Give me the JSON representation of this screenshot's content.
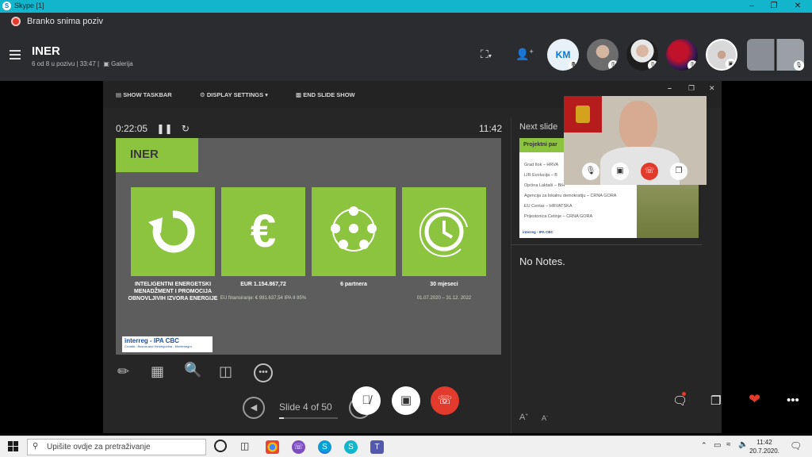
{
  "window": {
    "title": "Skype [1]"
  },
  "recording": {
    "text": "Branko snima poziv"
  },
  "call": {
    "title": "INER",
    "subtitle": "6 od 8 u pozivu | 33:47 |",
    "view_label": "Galerija"
  },
  "participants": [
    {
      "initials": "KM"
    }
  ],
  "presenter": {
    "toolbar": {
      "show_taskbar": "SHOW TASKBAR",
      "display_settings": "DISPLAY SETTINGS ▾",
      "end_slide_show": "END SLIDE SHOW"
    },
    "timer": "0:22:05",
    "clock": "11:42",
    "slide_counter": "Slide 4 of 50",
    "progress": 0.08,
    "next_slide_label": "Next slide",
    "notes": "No Notes."
  },
  "slide": {
    "title": "INER",
    "tiles": [
      {
        "icon": "cycle-arrow-icon",
        "label": "INTELIGENTNI ENERGETSKI MENADŽMENT I PROMOCIJA OBNOVLJIVIH IZVORA ENERGIJE",
        "sub": ""
      },
      {
        "icon": "euro-icon",
        "label": "EUR  1.154.867,72",
        "sub": "EU finansiranje: € 981.637,54 IPA II 85%"
      },
      {
        "icon": "people-network-icon",
        "label": "6 partnera",
        "sub": ""
      },
      {
        "icon": "clock-icon",
        "label": "30 mjeseci",
        "sub": "01.07.2020 – 31.12. 2022"
      }
    ],
    "logo_text": "interreg - IPA CBC",
    "logo_sub": "Croatia - Bosnia and Herzegovina - Montenegro"
  },
  "next_slide": {
    "header": "Projektni par",
    "items": [
      "Grad Ilok – HRVA",
      "LIR Evolucija – B",
      "Općina Laktaši – BiH",
      "Agencija za lokalnu demokratiju – CRNA GORA",
      "EU Centar – HRVATSKA",
      "Prijestonica Cetinje – CRNA GORA"
    ],
    "logo_text": "interreg - IPA CBC"
  },
  "taskbar": {
    "search_placeholder": "Upišite ovdje za pretraživanje",
    "time": "11:42",
    "date": "20.7.2020."
  },
  "colors": {
    "accent_green": "#8cc43f",
    "end_call_red": "#e23a2d",
    "skype_cyan": "#12b5cb"
  }
}
